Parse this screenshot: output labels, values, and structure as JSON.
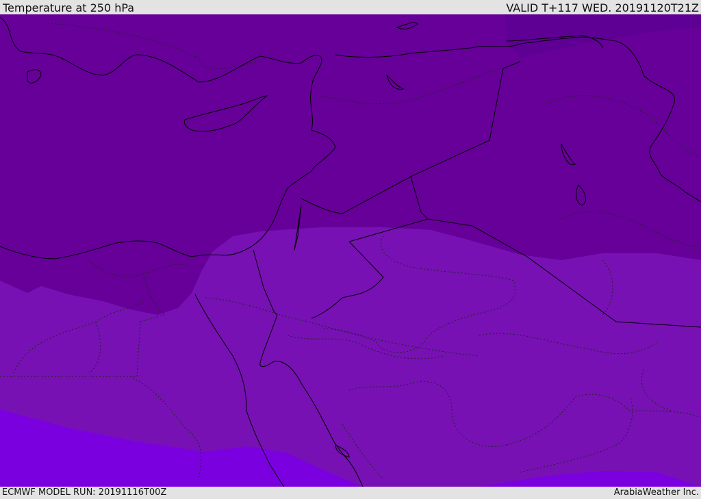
{
  "header": {
    "title": "Temperature at 250 hPa",
    "valid": "VALID T+117 WED. 20191120T21Z"
  },
  "footer": {
    "model_run": "ECMWF MODEL RUN: 20191116T00Z",
    "credit": "ArabiaWeather Inc."
  },
  "colors": {
    "band_coldest": "#5e0094",
    "band_cold": "#660099",
    "band_mid": "#7711b3",
    "band_warm": "#7b00e0",
    "coastline": "#000000",
    "background": "#e3e3e3"
  }
}
